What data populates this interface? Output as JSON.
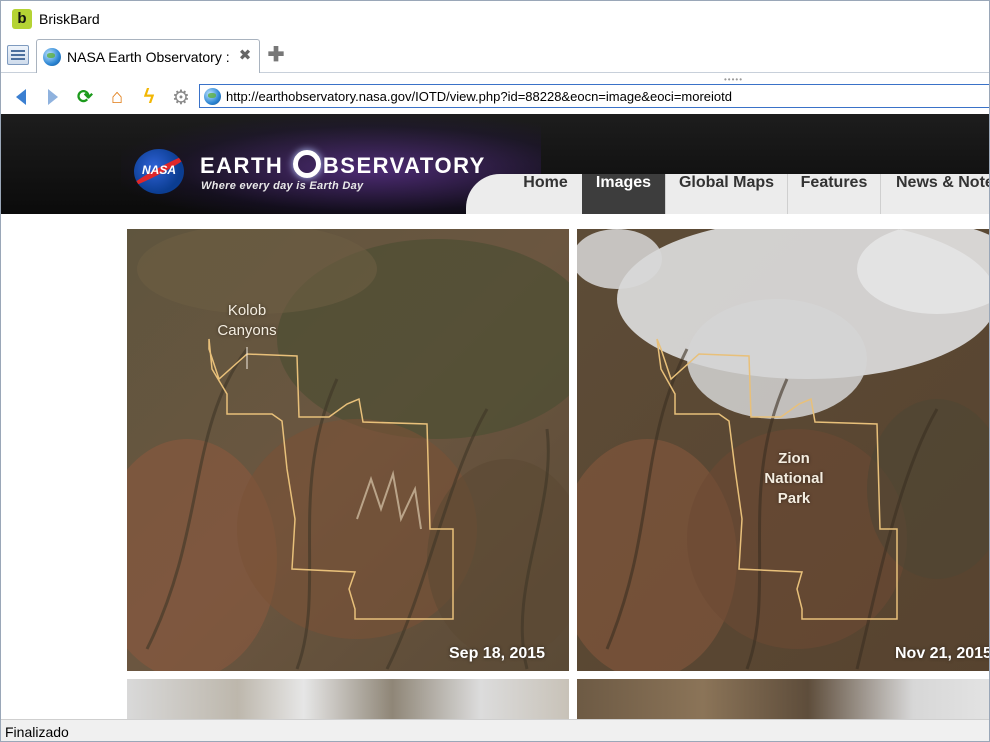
{
  "window": {
    "app_title": "BriskBard",
    "app_icon_letter": "b"
  },
  "tabs": [
    {
      "title": "NASA Earth Observatory :",
      "close_symbol": "✖"
    }
  ],
  "new_tab_symbol": "✚",
  "toolbar": {
    "url": "http://earthobservatory.nasa.gov/IOTD/view.php?id=88228&eocn=image&eoci=moreiotd",
    "icons": [
      "back-icon",
      "forward-icon",
      "refresh-icon",
      "home-icon",
      "lightning-icon",
      "settings-icon"
    ]
  },
  "site": {
    "logo_text": "NASA",
    "title_pre": "EARTH ",
    "title_post": "BSERVATORY",
    "tagline": "Where every day is Earth Day",
    "nav": [
      {
        "label": "Home",
        "active": false
      },
      {
        "label": "Images",
        "active": true
      },
      {
        "label": "Global Maps",
        "active": false
      },
      {
        "label": "Features",
        "active": false
      },
      {
        "label": "News & Notes",
        "active": false
      }
    ]
  },
  "images": [
    {
      "date": "Sep 18, 2015",
      "label_line1": "Kolob",
      "label_line2": "Canyons"
    },
    {
      "date": "Nov 21, 2015",
      "label_line1": "Zion",
      "label_line2": "National",
      "label_line3": "Park"
    }
  ],
  "status": {
    "text": "Finalizado"
  },
  "colors": {
    "header_bg": "#111111",
    "nav_active_bg": "#3d3d3d",
    "url_border": "#3a72c8",
    "boundary_line": "#e8c07a"
  }
}
